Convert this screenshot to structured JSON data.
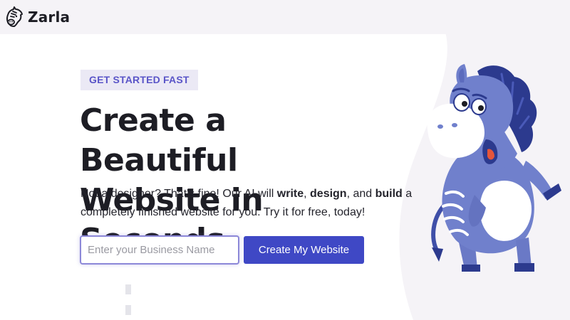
{
  "header": {
    "brand": "Zarla",
    "logo_icon": "zebra-head-icon"
  },
  "hero": {
    "badge": "GET STARTED FAST",
    "headline_line1": "Create a Beautiful",
    "headline_line2": "Website in Seconds",
    "subtitle": {
      "part1": "Not a designer? That's fine! Our AI will ",
      "bold1": "write",
      "sep1": ", ",
      "bold2": "design",
      "sep2": ", and ",
      "bold3": "build",
      "part2": " a completely finished website for you. Try it for free, today!"
    },
    "input_placeholder": "Enter your Business Name",
    "input_value": "",
    "button_label": "Create My Website",
    "mascot": "zebra-mascot-illustration"
  },
  "colors": {
    "accent": "#3f48c5",
    "badge_bg": "#ebe9f5",
    "badge_text": "#5a55c8",
    "zebra_body": "#7080cc",
    "zebra_mane": "#2c3a8e",
    "header_bg": "#f5f3f7"
  }
}
